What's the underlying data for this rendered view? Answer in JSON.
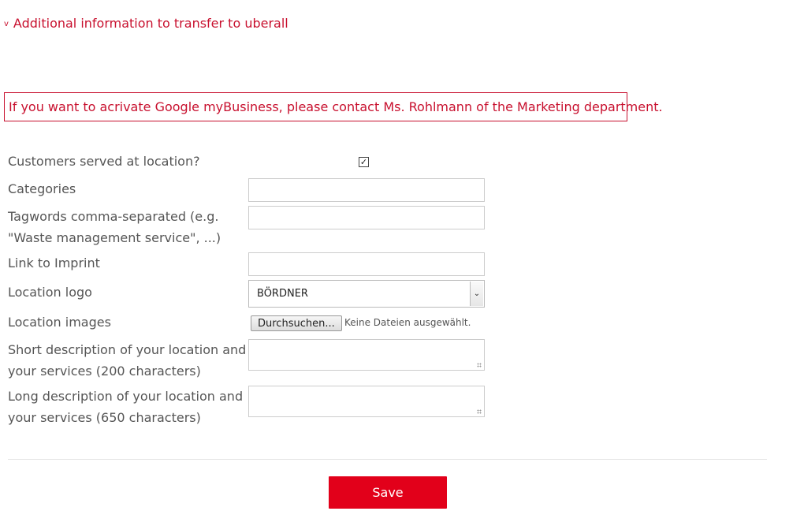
{
  "section": {
    "toggle_icon": "chevron-down-icon",
    "title": "Additional information to transfer to uberall"
  },
  "notice": {
    "text": "If you want to acrivate Google myBusiness, please contact Ms. Rohlmann of the Marketing department."
  },
  "form": {
    "customers_served": {
      "label": "Customers served at location?",
      "checked": true
    },
    "categories": {
      "label": "Categories",
      "value": ""
    },
    "tagwords": {
      "label_line1": "Tagwords comma-separated (e.g.",
      "label_line2": "\"Waste management service\", ...)",
      "value": ""
    },
    "imprint": {
      "label": "Link to Imprint",
      "value": ""
    },
    "logo": {
      "label": "Location logo",
      "selected": "BÖRDNER"
    },
    "images": {
      "label": "Location images",
      "button": "Durchsuchen...",
      "status": "Keine Dateien ausgewählt."
    },
    "short_desc": {
      "label_line1": "Short description of your location and",
      "label_line2": "your services (200 characters)"
    },
    "long_desc": {
      "label_line1": "Long description of your location and",
      "label_line2": "your services (650 characters)"
    }
  },
  "actions": {
    "save_label": "Save"
  },
  "colors": {
    "accent": "#c8102e",
    "button": "#e2001a"
  }
}
